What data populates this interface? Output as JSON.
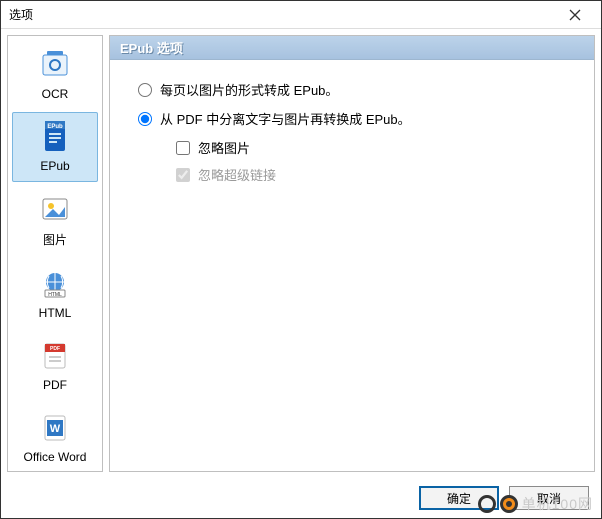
{
  "window": {
    "title": "选项"
  },
  "sidebar": {
    "items": [
      {
        "label": "OCR"
      },
      {
        "label": "EPub"
      },
      {
        "label": "图片"
      },
      {
        "label": "HTML"
      },
      {
        "label": "PDF"
      },
      {
        "label": "Office Word"
      }
    ],
    "selected_index": 1
  },
  "panel": {
    "heading": "EPub 选项",
    "radio1_label": "每页以图片的形式转成 EPub。",
    "radio2_label": "从 PDF 中分离文字与图片再转换成 EPub。",
    "selected_radio": 2,
    "check1_label": "忽略图片",
    "check1_checked": false,
    "check2_label": "忽略超级链接",
    "check2_checked": true,
    "check2_disabled": true
  },
  "footer": {
    "ok_label": "确定",
    "cancel_label": "取消"
  },
  "watermark": {
    "text": "单机100网"
  }
}
